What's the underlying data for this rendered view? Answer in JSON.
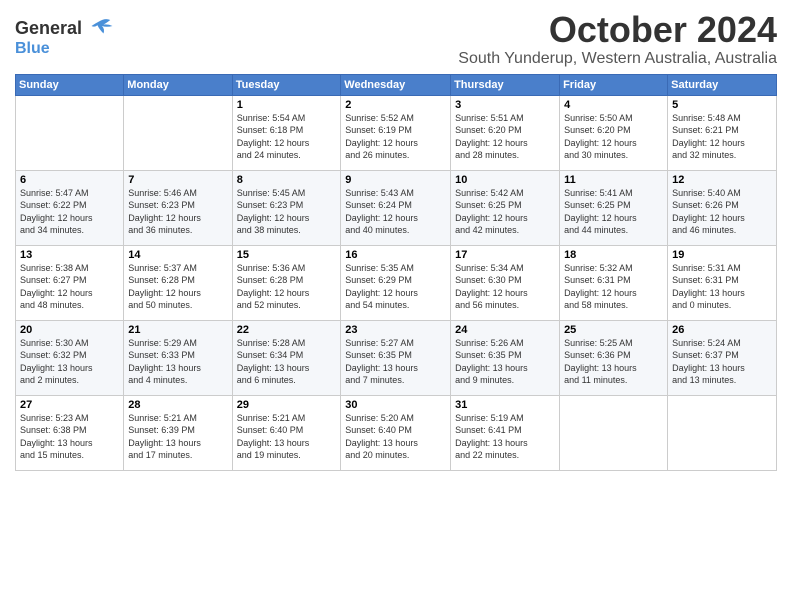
{
  "logo": {
    "line1": "General",
    "line2": "Blue"
  },
  "title": "October 2024",
  "location": "South Yunderup, Western Australia, Australia",
  "days_of_week": [
    "Sunday",
    "Monday",
    "Tuesday",
    "Wednesday",
    "Thursday",
    "Friday",
    "Saturday"
  ],
  "weeks": [
    [
      {
        "day": "",
        "info": ""
      },
      {
        "day": "",
        "info": ""
      },
      {
        "day": "1",
        "info": "Sunrise: 5:54 AM\nSunset: 6:18 PM\nDaylight: 12 hours\nand 24 minutes."
      },
      {
        "day": "2",
        "info": "Sunrise: 5:52 AM\nSunset: 6:19 PM\nDaylight: 12 hours\nand 26 minutes."
      },
      {
        "day": "3",
        "info": "Sunrise: 5:51 AM\nSunset: 6:20 PM\nDaylight: 12 hours\nand 28 minutes."
      },
      {
        "day": "4",
        "info": "Sunrise: 5:50 AM\nSunset: 6:20 PM\nDaylight: 12 hours\nand 30 minutes."
      },
      {
        "day": "5",
        "info": "Sunrise: 5:48 AM\nSunset: 6:21 PM\nDaylight: 12 hours\nand 32 minutes."
      }
    ],
    [
      {
        "day": "6",
        "info": "Sunrise: 5:47 AM\nSunset: 6:22 PM\nDaylight: 12 hours\nand 34 minutes."
      },
      {
        "day": "7",
        "info": "Sunrise: 5:46 AM\nSunset: 6:23 PM\nDaylight: 12 hours\nand 36 minutes."
      },
      {
        "day": "8",
        "info": "Sunrise: 5:45 AM\nSunset: 6:23 PM\nDaylight: 12 hours\nand 38 minutes."
      },
      {
        "day": "9",
        "info": "Sunrise: 5:43 AM\nSunset: 6:24 PM\nDaylight: 12 hours\nand 40 minutes."
      },
      {
        "day": "10",
        "info": "Sunrise: 5:42 AM\nSunset: 6:25 PM\nDaylight: 12 hours\nand 42 minutes."
      },
      {
        "day": "11",
        "info": "Sunrise: 5:41 AM\nSunset: 6:25 PM\nDaylight: 12 hours\nand 44 minutes."
      },
      {
        "day": "12",
        "info": "Sunrise: 5:40 AM\nSunset: 6:26 PM\nDaylight: 12 hours\nand 46 minutes."
      }
    ],
    [
      {
        "day": "13",
        "info": "Sunrise: 5:38 AM\nSunset: 6:27 PM\nDaylight: 12 hours\nand 48 minutes."
      },
      {
        "day": "14",
        "info": "Sunrise: 5:37 AM\nSunset: 6:28 PM\nDaylight: 12 hours\nand 50 minutes."
      },
      {
        "day": "15",
        "info": "Sunrise: 5:36 AM\nSunset: 6:28 PM\nDaylight: 12 hours\nand 52 minutes."
      },
      {
        "day": "16",
        "info": "Sunrise: 5:35 AM\nSunset: 6:29 PM\nDaylight: 12 hours\nand 54 minutes."
      },
      {
        "day": "17",
        "info": "Sunrise: 5:34 AM\nSunset: 6:30 PM\nDaylight: 12 hours\nand 56 minutes."
      },
      {
        "day": "18",
        "info": "Sunrise: 5:32 AM\nSunset: 6:31 PM\nDaylight: 12 hours\nand 58 minutes."
      },
      {
        "day": "19",
        "info": "Sunrise: 5:31 AM\nSunset: 6:31 PM\nDaylight: 13 hours\nand 0 minutes."
      }
    ],
    [
      {
        "day": "20",
        "info": "Sunrise: 5:30 AM\nSunset: 6:32 PM\nDaylight: 13 hours\nand 2 minutes."
      },
      {
        "day": "21",
        "info": "Sunrise: 5:29 AM\nSunset: 6:33 PM\nDaylight: 13 hours\nand 4 minutes."
      },
      {
        "day": "22",
        "info": "Sunrise: 5:28 AM\nSunset: 6:34 PM\nDaylight: 13 hours\nand 6 minutes."
      },
      {
        "day": "23",
        "info": "Sunrise: 5:27 AM\nSunset: 6:35 PM\nDaylight: 13 hours\nand 7 minutes."
      },
      {
        "day": "24",
        "info": "Sunrise: 5:26 AM\nSunset: 6:35 PM\nDaylight: 13 hours\nand 9 minutes."
      },
      {
        "day": "25",
        "info": "Sunrise: 5:25 AM\nSunset: 6:36 PM\nDaylight: 13 hours\nand 11 minutes."
      },
      {
        "day": "26",
        "info": "Sunrise: 5:24 AM\nSunset: 6:37 PM\nDaylight: 13 hours\nand 13 minutes."
      }
    ],
    [
      {
        "day": "27",
        "info": "Sunrise: 5:23 AM\nSunset: 6:38 PM\nDaylight: 13 hours\nand 15 minutes."
      },
      {
        "day": "28",
        "info": "Sunrise: 5:21 AM\nSunset: 6:39 PM\nDaylight: 13 hours\nand 17 minutes."
      },
      {
        "day": "29",
        "info": "Sunrise: 5:21 AM\nSunset: 6:40 PM\nDaylight: 13 hours\nand 19 minutes."
      },
      {
        "day": "30",
        "info": "Sunrise: 5:20 AM\nSunset: 6:40 PM\nDaylight: 13 hours\nand 20 minutes."
      },
      {
        "day": "31",
        "info": "Sunrise: 5:19 AM\nSunset: 6:41 PM\nDaylight: 13 hours\nand 22 minutes."
      },
      {
        "day": "",
        "info": ""
      },
      {
        "day": "",
        "info": ""
      }
    ]
  ]
}
